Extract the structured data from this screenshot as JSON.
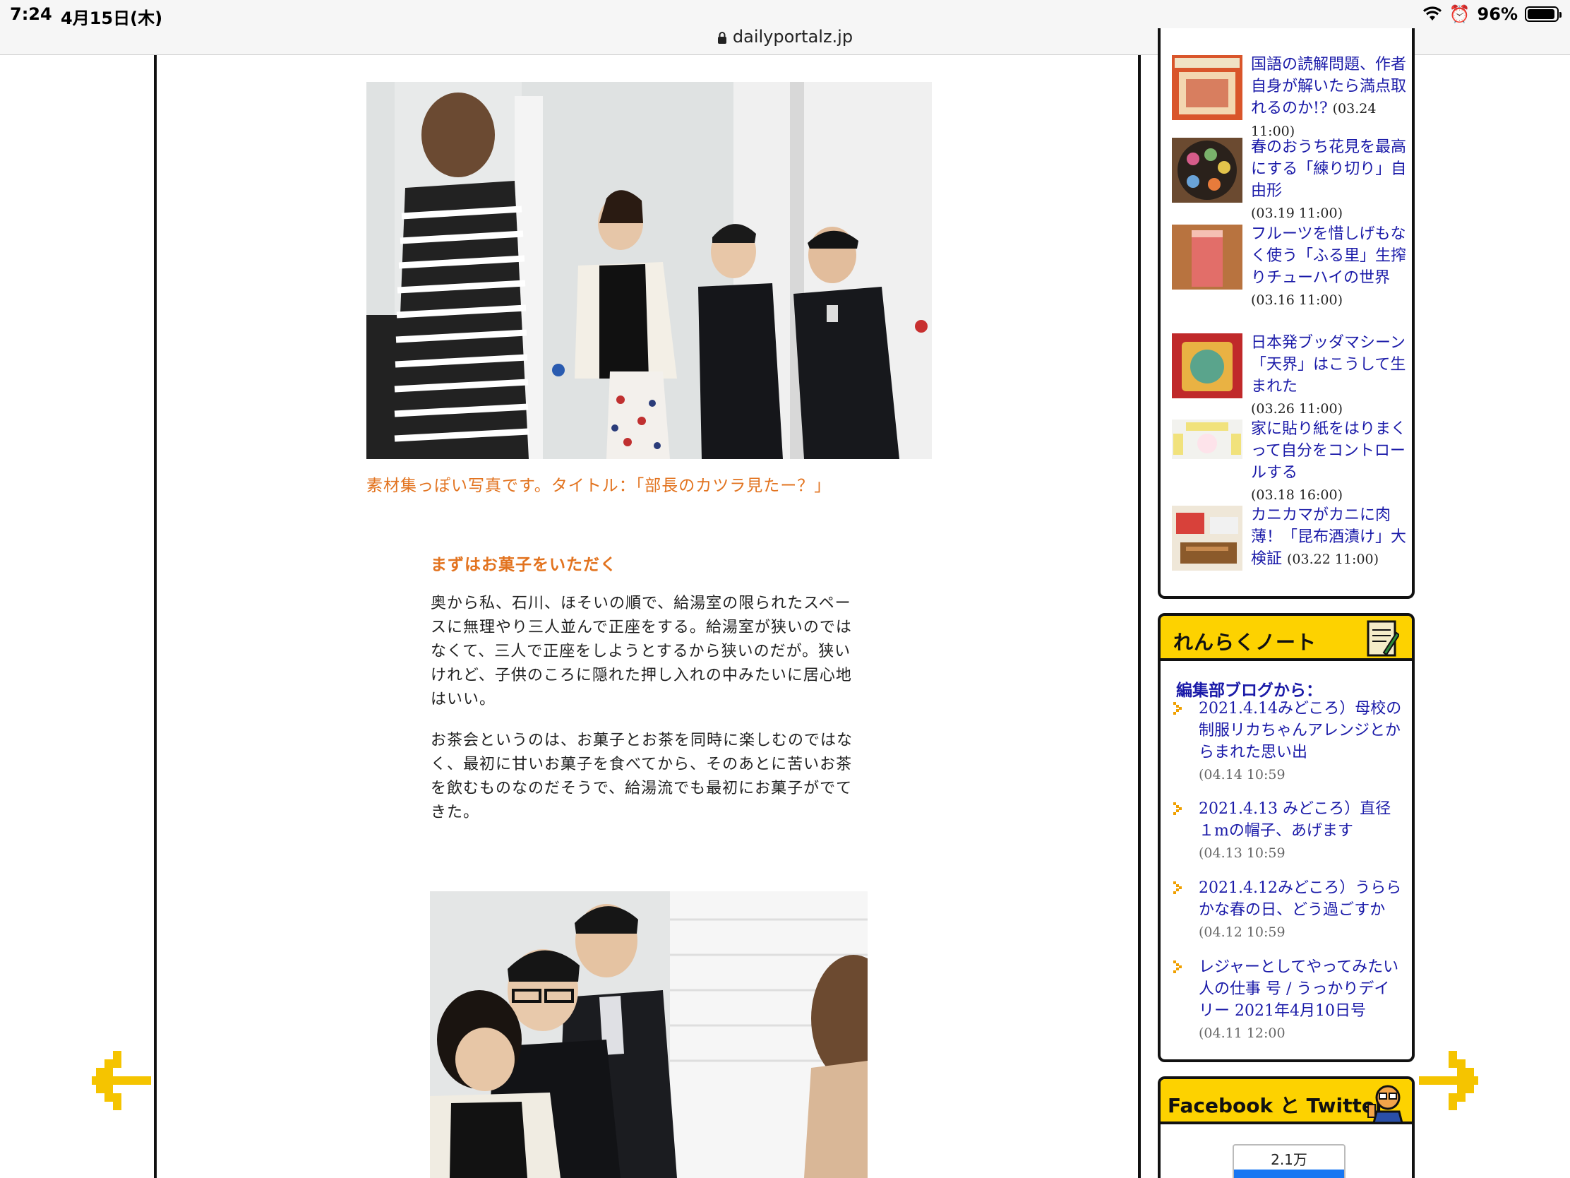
{
  "status": {
    "time": "7:24",
    "date": "4月15日(木)",
    "battery": "96%",
    "battery_level": 0.96,
    "url": "dailyportalz.jp"
  },
  "article": {
    "caption": "素材集っぽい写真です。タイトル：「部長のカツラ見たー？」",
    "heading": "まずはお菓子をいただく",
    "paragraph1": "奥から私、石川、ほそいの順で、給湯室の限られたスペースに無理やり三人並んで正座をする。給湯室が狭いのではなくて、三人で正座をしようとするから狭いのだが。狭いけれど、子供のころに隠れた押し入れの中みたいに居心地はいい。",
    "paragraph2": "お茶会というのは、お菓子とお茶を同時に楽しむのではなく、最初に甘いお菓子を食べてから、そのあとに苦いお茶を飲むものなのだそうで、給湯流でも最初にお菓子がでてきた。"
  },
  "sidebar": {
    "articles": [
      {
        "title": "国語の読解問題、作者自身が解いたら満点取れるのか!?",
        "date": "(03.24 11:00)"
      },
      {
        "title": "春のおうち花見を最高にする「練り切り」自由形",
        "date": "(03.19 11:00)"
      },
      {
        "title": "フルーツを惜しげもなく使う「ふる里」生搾りチューハイの世界",
        "date": "(03.16 11:00)"
      },
      {
        "title": "日本発ブッダマシーン「天界」はこうして生まれた",
        "date": "(03.26 11:00)"
      },
      {
        "title": "家に貼り紙をはりまくって自分をコントロールする",
        "date": "(03.18 16:00)"
      },
      {
        "title": "カニカマがカニに肉薄！「昆布酒漬け」大検証",
        "date": "(03.22 11:00)"
      }
    ],
    "renraku": {
      "title": "れんらくノート",
      "blog_label": "編集部ブログから：",
      "items": [
        {
          "title": "2021.4.14みどころ）母校の制服リカちゃんアレンジとからまれた思い出",
          "date": "(04.14 10:59"
        },
        {
          "title": "2021.4.13 みどころ）直径１mの帽子、あげます",
          "date": "(04.13 10:59"
        },
        {
          "title": "2021.4.12みどころ）うららかな春の日、どう過ごすか",
          "date": "(04.12 10:59"
        },
        {
          "title": "レジャーとしてやってみたい人の仕事 号 / うっかりデイリー 2021年4月10日号",
          "date": "(04.11 12:00"
        }
      ]
    },
    "social": {
      "title": "Facebook と Twitter",
      "like_count": "2.1万"
    }
  },
  "colors": {
    "accent_orange": "#e2731f",
    "link_blue": "#1a1aa8",
    "header_yellow": "#fdd200",
    "arrow_yellow": "#f5c400"
  }
}
